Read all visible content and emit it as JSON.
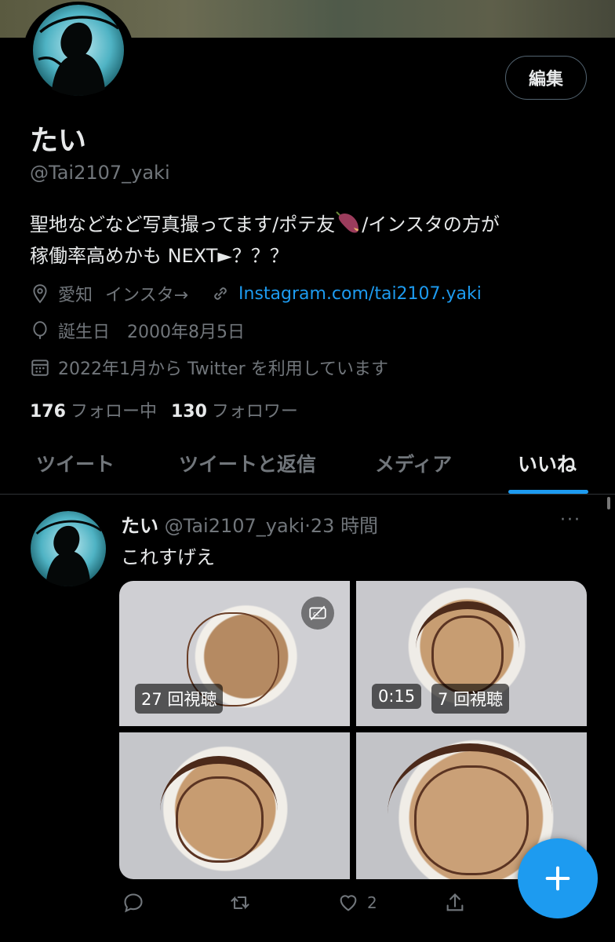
{
  "profile": {
    "name": "たい",
    "handle": "@Tai2107_yaki",
    "edit_label": "編集",
    "bio_part1": "聖地などなど写真撮ってます/ポテ友",
    "bio_part2": "/インスタの方が",
    "bio_line2": "稼働率高めかも NEXT►？？？",
    "location": "愛知",
    "location_extra": "インスタ→",
    "link": "Instagram.com/tai2107.yaki",
    "birthday": "誕生日　2000年8月5日",
    "joined": "2022年1月から Twitter を利用しています",
    "following_count": "176",
    "following_label": "フォロー中",
    "followers_count": "130",
    "followers_label": "フォロワー"
  },
  "tabs": [
    {
      "label": "ツイート"
    },
    {
      "label": "ツイートと返信"
    },
    {
      "label": "メディア"
    },
    {
      "label": "いいね",
      "active": true
    }
  ],
  "tweet": {
    "name": "たい",
    "handle": "@Tai2107_yaki",
    "time": "·23 時間",
    "text": "これすげえ",
    "media": [
      {
        "views": "27 回視聴"
      },
      {
        "duration": "0:15",
        "views": "7 回視聴"
      },
      {},
      {}
    ],
    "like_count": "2"
  },
  "colors": {
    "accent": "#1d9bf0",
    "background": "#000000",
    "text_secondary": "#71767b"
  },
  "icons": {
    "location": "location-pin-icon",
    "link": "link-icon",
    "birthday": "balloon-icon",
    "joined": "calendar-icon",
    "reply": "reply-icon",
    "retweet": "retweet-icon",
    "like": "heart-icon",
    "share": "share-icon",
    "compose": "plus-icon"
  }
}
